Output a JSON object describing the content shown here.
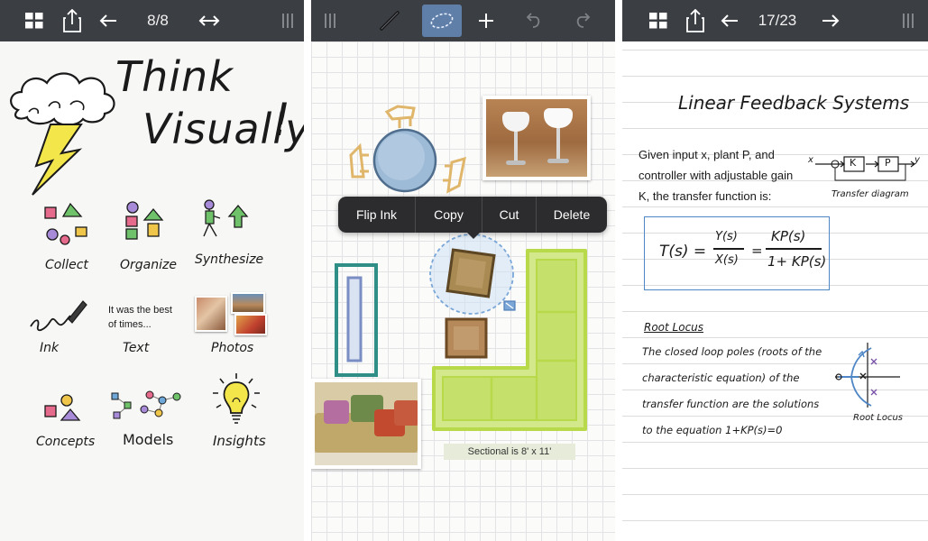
{
  "colors": {
    "toolbar_bg": "#3b3e43",
    "lasso_accent": "#7aa7d8",
    "equation_box": "#4f86c6",
    "sofa_green": "#b7d94a",
    "chair_orange": "#e0b66a",
    "table_blue": "#9dbad6",
    "accent_yellow": "#f3e64a"
  },
  "panel1": {
    "toolbar": {
      "page_counter": "8/8",
      "icons": [
        "grid-icon",
        "share-icon",
        "arrow-left-icon",
        "expand-horizontal-icon",
        "panel-lines-icon"
      ]
    },
    "headline": {
      "line1": "Think",
      "line2": "Visually",
      "mark": "!"
    },
    "tiles": [
      {
        "label": "Collect",
        "icon": "shapes-icon"
      },
      {
        "label": "Organize",
        "icon": "stacked-shapes-icon"
      },
      {
        "label": "Synthesize",
        "icon": "person-arrow-icon"
      },
      {
        "label": "Ink",
        "icon": "pen-scribble-icon"
      },
      {
        "label": "Text",
        "icon": "text-icon"
      },
      {
        "label": "Photos",
        "icon": "photos-icon"
      },
      {
        "label": "Concepts",
        "icon": "concept-shapes-icon"
      },
      {
        "label": "Models",
        "icon": "network-icon"
      },
      {
        "label": "Insights",
        "icon": "lightbulb-icon"
      }
    ],
    "text_sample": {
      "line1": "It was the best",
      "line2": "of times..."
    }
  },
  "panel2": {
    "toolbar": {
      "icons": [
        "panel-lines-icon",
        "pen-tool-icon",
        "lasso-tool-icon",
        "plus-icon",
        "undo-icon",
        "redo-icon"
      ]
    },
    "context_menu": [
      "Flip Ink",
      "Copy",
      "Cut",
      "Delete"
    ],
    "caption": "Sectional is 8' x 11'"
  },
  "panel3": {
    "toolbar": {
      "page_counter": "17/23",
      "icons": [
        "grid-icon",
        "share-icon",
        "arrow-left-icon",
        "arrow-right-icon",
        "panel-lines-icon"
      ]
    },
    "title": "Linear Feedback Systems",
    "intro_lines": [
      "Given input x, plant P, and",
      "controller with adjustable gain",
      "K, the transfer function is:"
    ],
    "diagram": {
      "x": "x",
      "k": "K",
      "p": "P",
      "y": "y",
      "caption": "Transfer diagram"
    },
    "equation": {
      "lhs": "T(s) =",
      "frac1_num": "Y(s)",
      "frac1_den": "X(s)",
      "eq": "=",
      "frac2_num": "KP(s)",
      "frac2_den": "1+ KP(s)"
    },
    "section_title": "Root Locus",
    "body_lines": [
      "The closed loop poles (roots of the",
      "characteristic equation) of the",
      "transfer function are the solutions",
      "to the equation   1+KP(s)=0"
    ],
    "locus_caption": "Root Locus"
  }
}
